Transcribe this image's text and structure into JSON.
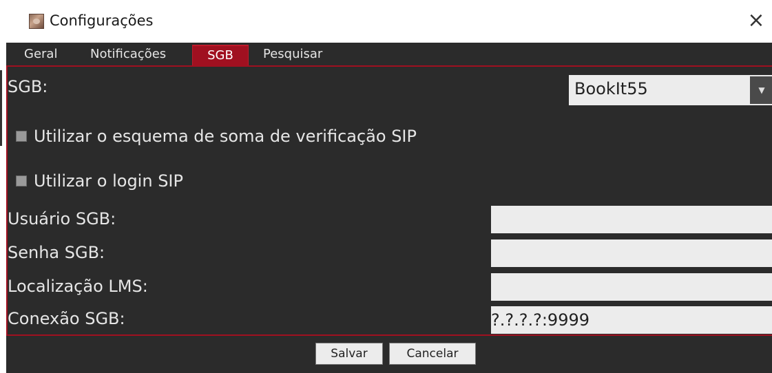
{
  "window": {
    "title": "Configurações",
    "close_glyph": "×"
  },
  "tabs": [
    {
      "label": "Geral"
    },
    {
      "label": "Notificações"
    },
    {
      "label": "SGB"
    },
    {
      "label": "Pesquisar"
    }
  ],
  "active_tab": "SGB",
  "sgb": {
    "sgb_label": "SGB:",
    "sgb_selected": "BookIt55",
    "checksum_label": "Utilizar o esquema de soma de verificação SIP",
    "checksum_checked": false,
    "sip_login_label": "Utilizar o login SIP",
    "sip_login_checked": false,
    "user_label": "Usuário SGB:",
    "user_value": "",
    "password_label": "Senha SGB:",
    "password_value": "",
    "location_label": "Localização LMS:",
    "location_value": "",
    "connection_label": "Conexão SGB:",
    "connection_value": "?.?.?.?:9999"
  },
  "buttons": {
    "save_label": "Salvar",
    "cancel_label": "Cancelar"
  },
  "colors": {
    "panel_bg": "#2b2b2b",
    "accent": "#a01020",
    "text": "#e6e6e6",
    "field_bg": "#ececec"
  }
}
